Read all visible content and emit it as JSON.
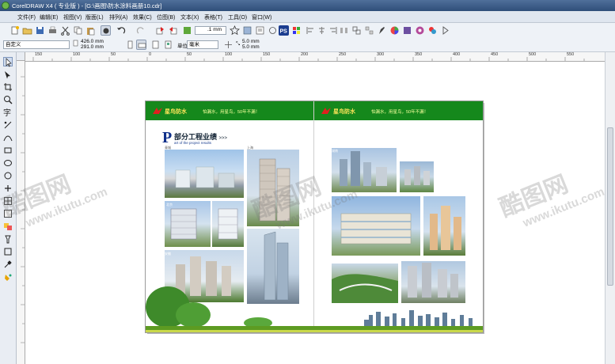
{
  "window": {
    "title": "CorelDRAW X4 ( 专业版 ) - [G:\\画图\\防水涂料画册10.cdr]"
  },
  "menu": [
    "文件(F)",
    "编辑(E)",
    "视图(V)",
    "版面(L)",
    "排列(A)",
    "效果(C)",
    "位图(B)",
    "文本(X)",
    "表格(T)",
    "工具(O)",
    "窗口(W)"
  ],
  "property_bar": {
    "page_preset": "自定义",
    "width": "426.0 mm",
    "height": "291.0 mm",
    "units_label": "单位:",
    "units": "毫米",
    "nudge": ".1 mm",
    "dup_x": "5.0 mm",
    "dup_y": "5.0 mm"
  },
  "ruler": {
    "ticks": [
      "150",
      "100",
      "50",
      "0",
      "50",
      "100",
      "150",
      "200",
      "250",
      "300",
      "350",
      "400",
      "450",
      "500",
      "550"
    ]
  },
  "document": {
    "brand": "星鸟防水",
    "slogan": "怕漏水，用星鸟，50年不漏！",
    "section_title": "部分工程业绩",
    "section_arrows": ">>>",
    "section_subtitle": "art of the project results",
    "big_letter": "P",
    "captions": [
      "青城",
      "上海",
      "北京",
      "安徽",
      "湖南"
    ]
  },
  "watermarks": [
    {
      "cn": "酷图网",
      "url": "www.ikutu.com"
    },
    {
      "cn": "酷图网",
      "url": "www.ikutu.com"
    },
    {
      "cn": "酷图网",
      "url": "www.ikutu.com"
    }
  ],
  "colors": {
    "band_green": "#15881c",
    "brand_yellow": "#ffe55a",
    "title_blue": "#0e2f8a"
  }
}
